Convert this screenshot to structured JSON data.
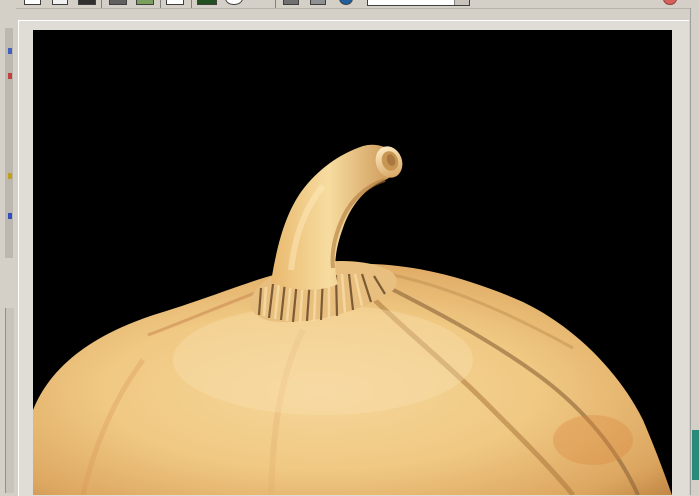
{
  "toolbar": {
    "buttons": [
      {
        "name": "render-region-icon"
      },
      {
        "name": "render-frame-icon"
      },
      {
        "name": "render-output-icon"
      },
      {
        "name": "zoom-channel-icon"
      },
      {
        "name": "mono-channel-icon"
      },
      {
        "name": "alpha-channel-icon"
      },
      {
        "name": "color-swatch-icon"
      },
      {
        "name": "clear-icon"
      },
      {
        "name": "save-image-icon"
      },
      {
        "name": "copy-image-icon"
      },
      {
        "name": "sphere-preview-icon"
      }
    ],
    "field_value": ""
  },
  "viewport": {
    "background_color": "#000000",
    "subject": "pumpkin-render"
  },
  "colors": {
    "pumpkin_light": "#f3cf8c",
    "pumpkin_mid": "#e3b06a",
    "pumpkin_dark": "#b9813f",
    "ui_gray": "#d4d0c8",
    "accent": "#2a8a7a"
  }
}
